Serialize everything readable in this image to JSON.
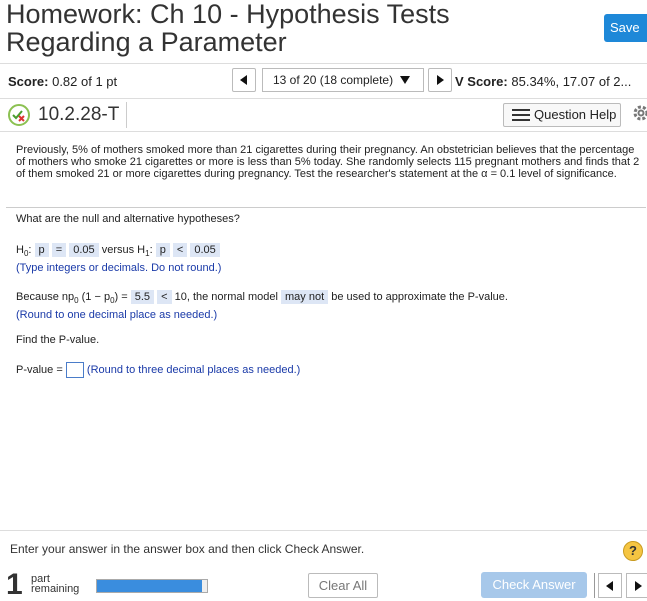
{
  "header": {
    "title": "Homework: Ch 10 - Hypothesis Tests\nRegarding a Parameter",
    "save_label": "Save"
  },
  "score": {
    "label": "Score:",
    "value": "0.82 of 1 pt"
  },
  "nav": {
    "position_label": "13 of 20 (18 complete)"
  },
  "hw_score": {
    "label": "V Score:",
    "value": "85.34%, 17.07 of 2..."
  },
  "question": {
    "id": "10.2.28-T",
    "help_label": "Question Help"
  },
  "problem": {
    "text": "Previously, 5% of mothers smoked more than 21 cigarettes during their pregnancy. An obstetrician believes that the percentage of mothers who smoke 21 cigarettes or more is less than 5% today. She randomly selects 115 pregnant mothers and finds that 2 of them smoked 21 or more cigarettes during pregnancy. Test the researcher's statement at the α = 0.1 level of significance."
  },
  "hypotheses": {
    "prompt": "What are the null and alternative hypotheses?",
    "h0": "H",
    "h0_sub": "0",
    "h0_param": "p",
    "h0_op": "=",
    "h0_val": "0.05",
    "versus": "versus H",
    "h1_sub": "1",
    "h1_param": "p",
    "h1_op": "<",
    "h1_val": "0.05",
    "note": "(Type integers or decimals. Do not round.)"
  },
  "normal_model": {
    "prefix": "Because np",
    "sub0": "0",
    "mid": "(1 − p",
    "sub1": "0",
    "close": ") =",
    "value": "5.5",
    "op": "<",
    "after": "10, the normal model",
    "choice": "may not",
    "suffix": "be used to approximate the P-value.",
    "note": "(Round to one decimal place as needed.)"
  },
  "pvalue": {
    "prompt": "Find the P-value.",
    "label": "P-value =",
    "note": "(Round to three decimal places as needed.)"
  },
  "footer": {
    "instructions": "Enter your answer in the answer box and then click Check Answer.",
    "help_glyph": "?",
    "part_number": "1",
    "part_label_1": "part",
    "part_label_2": "remaining",
    "progress": 0.95,
    "clear_label": "Clear All",
    "check_label": "Check Answer"
  },
  "colors": {
    "accent": "#1e88d8",
    "answer_text": "#1a3aa8"
  }
}
